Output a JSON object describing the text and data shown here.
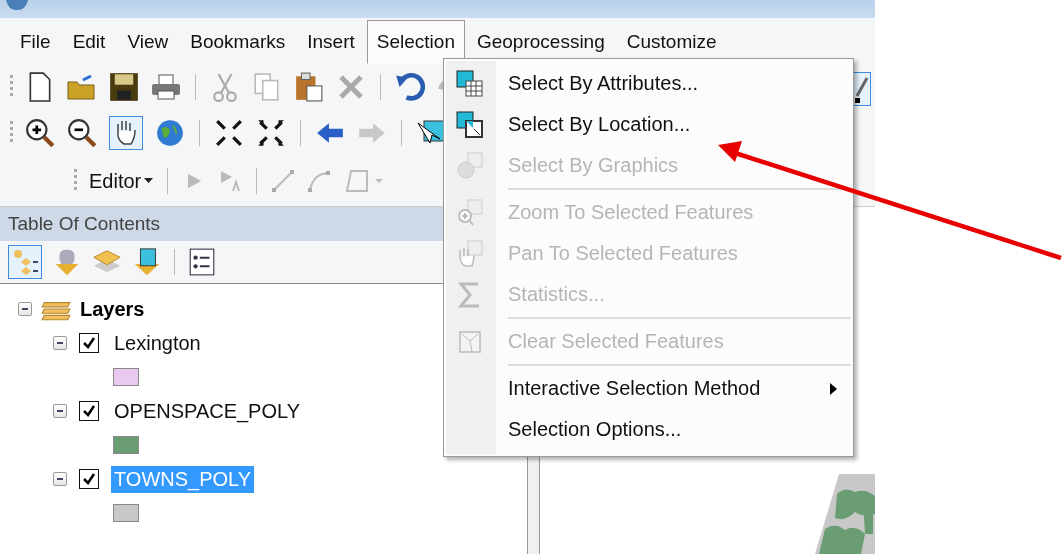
{
  "menu_bar": [
    {
      "label": "File",
      "selected": false
    },
    {
      "label": "Edit",
      "selected": false
    },
    {
      "label": "View",
      "selected": false
    },
    {
      "label": "Bookmarks",
      "selected": false
    },
    {
      "label": "Insert",
      "selected": false
    },
    {
      "label": "Selection",
      "selected": true
    },
    {
      "label": "Geoprocessing",
      "selected": false
    },
    {
      "label": "Customize",
      "selected": false
    }
  ],
  "editor_toolbar": {
    "label": "Editor"
  },
  "toc": {
    "title": "Table Of Contents",
    "tree": [
      {
        "label": "Layers",
        "expanded": true,
        "children": [
          {
            "label": "Lexington",
            "expanded": true,
            "checked": true,
            "selected": false,
            "color": "#e9c9ef"
          },
          {
            "label": "OPENSPACE_POLY",
            "expanded": true,
            "checked": true,
            "selected": false,
            "color": "#6b9d74"
          },
          {
            "label": "TOWNS_POLY",
            "expanded": true,
            "checked": true,
            "selected": true,
            "color": "#c8c8c8"
          }
        ]
      }
    ]
  },
  "selection_menu": {
    "items": [
      {
        "label": "Select By Attributes...",
        "disabled": false,
        "group_start": false,
        "has_submenu": false
      },
      {
        "label": "Select By Location...",
        "disabled": false,
        "group_start": false,
        "has_submenu": false
      },
      {
        "label": "Select By Graphics",
        "disabled": true,
        "group_start": false,
        "has_submenu": false
      },
      {
        "label": "Zoom To Selected Features",
        "disabled": true,
        "group_start": true,
        "has_submenu": false
      },
      {
        "label": "Pan To Selected Features",
        "disabled": true,
        "group_start": false,
        "has_submenu": false
      },
      {
        "label": "Statistics...",
        "disabled": true,
        "group_start": false,
        "has_submenu": false
      },
      {
        "label": "Clear Selected Features",
        "disabled": true,
        "group_start": true,
        "has_submenu": false
      },
      {
        "label": "Interactive Selection Method",
        "disabled": false,
        "group_start": true,
        "has_submenu": true
      },
      {
        "label": "Selection Options...",
        "disabled": false,
        "group_start": false,
        "has_submenu": false
      }
    ]
  }
}
